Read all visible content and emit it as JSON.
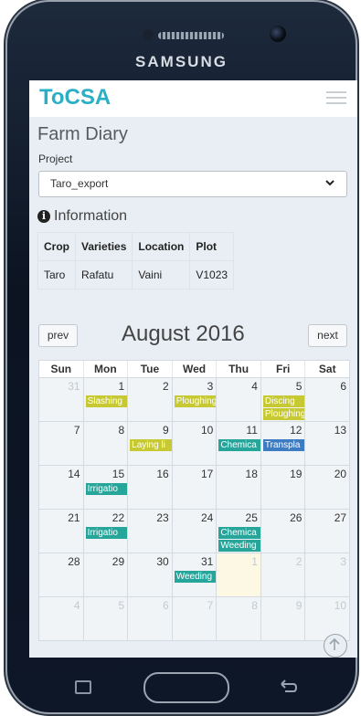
{
  "device": {
    "brand": "SAMSUNG"
  },
  "app": {
    "logo": "ToCSA"
  },
  "page": {
    "title": "Farm Diary"
  },
  "project": {
    "label": "Project",
    "selected": "Taro_export"
  },
  "information": {
    "heading": "Information",
    "columns": [
      "Crop",
      "Varieties",
      "Location",
      "Plot"
    ],
    "values": [
      "Taro",
      "Rafatu",
      "Vaini",
      "V1023"
    ]
  },
  "calendar": {
    "prev_label": "prev",
    "next_label": "next",
    "month_title": "August 2016",
    "weekdays": [
      "Sun",
      "Mon",
      "Tue",
      "Wed",
      "Thu",
      "Fri",
      "Sat"
    ],
    "weeks": [
      [
        {
          "d": "31",
          "other": true
        },
        {
          "d": "1",
          "events": [
            {
              "t": "Slashing",
              "c": "#c6c932"
            }
          ]
        },
        {
          "d": "2"
        },
        {
          "d": "3",
          "events": [
            {
              "t": "Ploughing",
              "c": "#c6c932"
            }
          ]
        },
        {
          "d": "4"
        },
        {
          "d": "5",
          "events": [
            {
              "t": "Discing",
              "c": "#c6c932"
            },
            {
              "t": "Ploughing",
              "c": "#c6c932"
            }
          ]
        },
        {
          "d": "6"
        }
      ],
      [
        {
          "d": "7"
        },
        {
          "d": "8"
        },
        {
          "d": "9",
          "events": [
            {
              "t": "Laying li",
              "c": "#c6c932"
            }
          ]
        },
        {
          "d": "10"
        },
        {
          "d": "11",
          "events": [
            {
              "t": "Chemica",
              "c": "#26a69a"
            }
          ]
        },
        {
          "d": "12",
          "events": [
            {
              "t": "Transpla",
              "c": "#3d7cc3"
            }
          ]
        },
        {
          "d": "13"
        }
      ],
      [
        {
          "d": "14"
        },
        {
          "d": "15",
          "events": [
            {
              "t": "Irrigatio",
              "c": "#26a69a"
            }
          ]
        },
        {
          "d": "16"
        },
        {
          "d": "17"
        },
        {
          "d": "18"
        },
        {
          "d": "19"
        },
        {
          "d": "20"
        }
      ],
      [
        {
          "d": "21"
        },
        {
          "d": "22",
          "events": [
            {
              "t": "Irrigatio",
              "c": "#26a69a"
            }
          ]
        },
        {
          "d": "23"
        },
        {
          "d": "24"
        },
        {
          "d": "25",
          "events": [
            {
              "t": "Chemica",
              "c": "#26a69a"
            },
            {
              "t": "Weeding",
              "c": "#26a69a"
            }
          ]
        },
        {
          "d": "26"
        },
        {
          "d": "27"
        }
      ],
      [
        {
          "d": "28"
        },
        {
          "d": "29"
        },
        {
          "d": "30"
        },
        {
          "d": "31",
          "events": [
            {
              "t": "Weeding",
              "c": "#26a69a"
            }
          ]
        },
        {
          "d": "1",
          "other": true,
          "today": true
        },
        {
          "d": "2",
          "other": true
        },
        {
          "d": "3",
          "other": true
        }
      ],
      [
        {
          "d": "4",
          "other": true
        },
        {
          "d": "5",
          "other": true
        },
        {
          "d": "6",
          "other": true
        },
        {
          "d": "7",
          "other": true
        },
        {
          "d": "8",
          "other": true
        },
        {
          "d": "9",
          "other": true
        },
        {
          "d": "10",
          "other": true
        }
      ]
    ]
  },
  "colors": {
    "brand": "#2ab0c4",
    "field_event": "#c6c932",
    "care_event": "#26a69a",
    "planting_event": "#3d7cc3",
    "today": "#fcf8e3"
  },
  "icons": [
    "hamburger-menu-icon",
    "chevron-down-icon",
    "info-circle-icon",
    "arrow-up-circle-icon",
    "recent-apps-icon",
    "back-icon"
  ]
}
